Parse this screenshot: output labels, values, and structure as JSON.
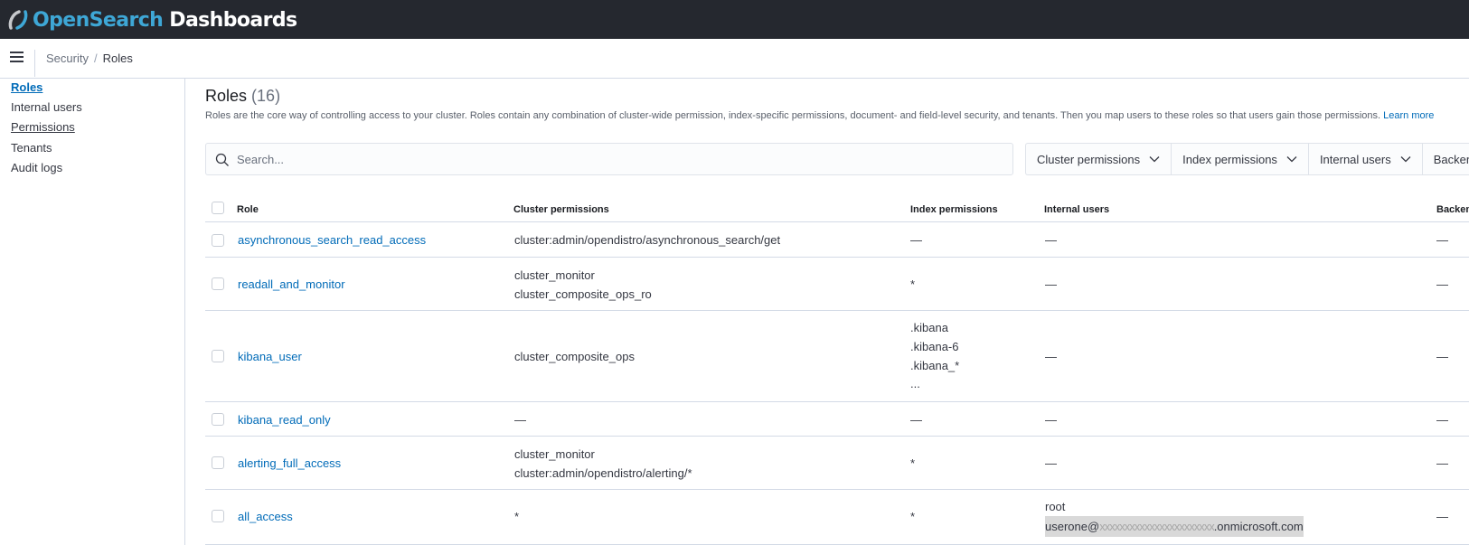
{
  "brand": {
    "name_part1": "Open",
    "name_part2": "Search",
    "name_part3": " Dashboards"
  },
  "breadcrumbs": {
    "first": "Security",
    "separator": "/",
    "current": "Roles"
  },
  "sidenav": {
    "items": [
      "Roles",
      "Internal users",
      "Permissions",
      "Tenants",
      "Audit logs"
    ]
  },
  "page": {
    "title": "Roles",
    "count": "(16)",
    "description": "Roles are the core way of controlling access to your cluster. Roles contain any combination of cluster-wide permission, index-specific permissions, document- and field-level security, and tenants. Then you map users to these roles so that users gain those permissions.",
    "learn_more": "Learn more"
  },
  "search": {
    "placeholder": "Search..."
  },
  "filters": [
    "Cluster permissions",
    "Index permissions",
    "Internal users",
    "Backend"
  ],
  "table": {
    "columns": [
      "Role",
      "Cluster permissions",
      "Index permissions",
      "Internal users",
      "Backen"
    ],
    "rows": [
      {
        "role": "asynchronous_search_read_access",
        "cluster": [
          "cluster:admin/opendistro/asynchronous_search/get"
        ],
        "index": [
          "—"
        ],
        "users": [
          "—"
        ],
        "backend": "—"
      },
      {
        "role": "readall_and_monitor",
        "cluster": [
          "cluster_monitor",
          "cluster_composite_ops_ro"
        ],
        "index": [
          "*"
        ],
        "users": [
          "—"
        ],
        "backend": "—"
      },
      {
        "role": "kibana_user",
        "cluster": [
          "cluster_composite_ops"
        ],
        "index": [
          ".kibana",
          ".kibana-6",
          ".kibana_*",
          "..."
        ],
        "users": [
          "—"
        ],
        "backend": "—"
      },
      {
        "role": "kibana_read_only",
        "cluster": [
          "—"
        ],
        "index": [
          "—"
        ],
        "users": [
          "—"
        ],
        "backend": "—"
      },
      {
        "role": "alerting_full_access",
        "cluster": [
          "cluster_monitor",
          "cluster:admin/opendistro/alerting/*"
        ],
        "index": [
          "*"
        ],
        "users": [
          "—"
        ],
        "backend": "—"
      },
      {
        "role": "all_access",
        "cluster": [
          "*"
        ],
        "index": [
          "*"
        ],
        "users": [
          "root"
        ],
        "user_masked": {
          "prefix": "userone@",
          "hidden": "xxxxxxxxxxxxxxxxxxxxxxx",
          "suffix": ".onmicrosoft.com"
        },
        "backend": "—"
      }
    ]
  },
  "colors": {
    "topbar": "#25282f",
    "brand_accent": "#3ea7d6",
    "link": "#006bb8",
    "border": "#d3dae6"
  }
}
